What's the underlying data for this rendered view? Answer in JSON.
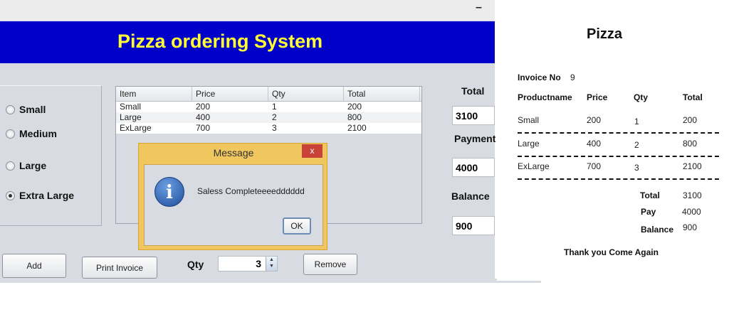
{
  "window": {
    "minimize_label": "–",
    "banner_title": "Pizza ordering System"
  },
  "sizes": [
    {
      "label": "Small",
      "selected": false
    },
    {
      "label": "Medium",
      "selected": false
    },
    {
      "label": "Large",
      "selected": false
    },
    {
      "label": "Extra Large",
      "selected": true
    }
  ],
  "table": {
    "headers": [
      "Item",
      "Price",
      "Qty",
      "Total"
    ],
    "rows": [
      [
        "Small",
        "200",
        "1",
        "200"
      ],
      [
        "Large",
        "400",
        "2",
        "800"
      ],
      [
        "ExLarge",
        "700",
        "3",
        "2100"
      ]
    ]
  },
  "summary": {
    "total_label": "Total",
    "total_value": "3100",
    "payment_label": "Payment",
    "payment_value": "4000",
    "balance_label": "Balance",
    "balance_value": "900"
  },
  "buttons": {
    "add": "Add",
    "print_invoice": "Print Invoice",
    "remove": "Remove"
  },
  "qty": {
    "label": "Qty",
    "value": "3"
  },
  "dialog": {
    "title": "Message",
    "close": "x",
    "message": "Saless Completeeeedddddd",
    "ok": "OK",
    "icon": "info-icon"
  },
  "receipt": {
    "title": "Pizza",
    "invoice_label": "Invoice No",
    "invoice_no": "9",
    "headers": [
      "Productname",
      "Price",
      "Qty",
      "Total"
    ],
    "rows": [
      [
        "Small",
        "200",
        "1",
        "200"
      ],
      [
        "Large",
        "400",
        "2",
        "800"
      ],
      [
        "ExLarge",
        "700",
        "3",
        "2100"
      ]
    ],
    "total_label": "Total",
    "total": "3100",
    "pay_label": "Pay",
    "pay": "4000",
    "balance_label": "Balance",
    "balance": "900",
    "footer": "Thank you Come Again"
  },
  "colors": {
    "banner_bg": "#0000c8",
    "banner_text": "#ffff33",
    "dialog_frame": "#f0c65f",
    "close_button": "#c9423a"
  }
}
